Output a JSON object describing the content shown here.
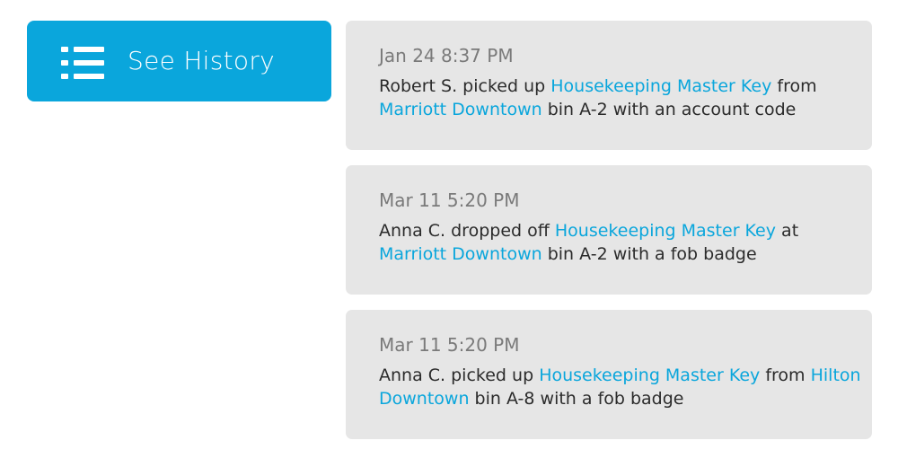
{
  "history_button": {
    "label": "See History",
    "icon": "list-icon"
  },
  "colors": {
    "accent": "#0aa6dc",
    "card_bg": "#e6e6e6",
    "time_text": "#7a7a7a",
    "body_text": "#2b2b2b"
  },
  "events": [
    {
      "time": "Jan 24 8:37 PM",
      "person": "Robert S.",
      "action": "picked up",
      "item": "Housekeeping Master Key",
      "preposition": "from",
      "location": "Marriott Downtown",
      "detail": "bin A-2 with an account code"
    },
    {
      "time": "Mar 11 5:20 PM",
      "person": "Anna C.",
      "action": "dropped off",
      "item": "Housekeeping Master Key",
      "preposition": "at",
      "location": "Marriott Downtown",
      "detail": "bin A-2 with a fob badge"
    },
    {
      "time": "Mar 11 5:20 PM",
      "person": "Anna C.",
      "action": "picked up",
      "item": "Housekeeping Master Key",
      "preposition": "from",
      "location": "Hilton Downtown",
      "detail": "bin A-8 with a fob badge"
    }
  ]
}
